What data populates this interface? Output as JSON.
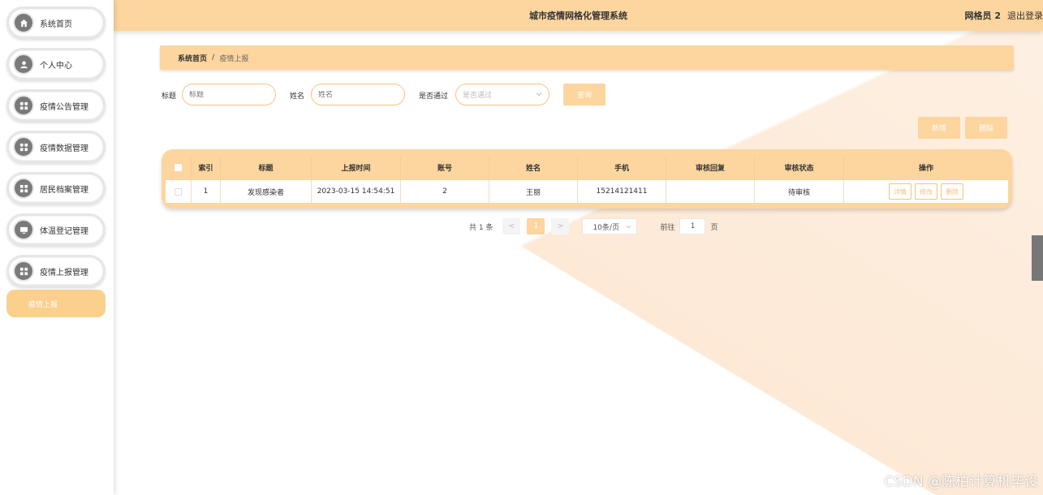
{
  "header": {
    "title": "城市疫情网格化管理系统",
    "user": "网格员 2",
    "logout": "退出登录"
  },
  "sidebar": {
    "items": [
      {
        "label": "系统首页",
        "icon": "home-icon"
      },
      {
        "label": "个人中心",
        "icon": "user-icon"
      },
      {
        "label": "疫情公告管理",
        "icon": "grid-icon"
      },
      {
        "label": "疫情数据管理",
        "icon": "grid-icon"
      },
      {
        "label": "居民档案管理",
        "icon": "grid-icon"
      },
      {
        "label": "体温登记管理",
        "icon": "monitor-icon"
      },
      {
        "label": "疫情上报管理",
        "icon": "grid-icon"
      }
    ],
    "submenu": {
      "label": "疫情上报"
    }
  },
  "breadcrumb": {
    "home": "系统首页",
    "separator": "/",
    "current": "疫情上报"
  },
  "search": {
    "title_label": "标题",
    "title_placeholder": "标题",
    "name_label": "姓名",
    "name_placeholder": "姓名",
    "passed_label": "是否通过",
    "passed_placeholder": "是否通过",
    "query_button": "查询"
  },
  "actions": {
    "add": "新增",
    "delete": "删除"
  },
  "table": {
    "columns": [
      "索引",
      "标题",
      "上报时间",
      "账号",
      "姓名",
      "手机",
      "审核回复",
      "审核状态",
      "操作"
    ],
    "rows": [
      {
        "index": "1",
        "title": "发现感染者",
        "time": "2023-03-15 14:54:51",
        "account": "2",
        "name": "王丽",
        "phone": "15214121411",
        "reply": "",
        "status": "待审核",
        "ops": {
          "detail": "详情",
          "edit": "修改",
          "delete": "删除"
        }
      }
    ]
  },
  "pagination": {
    "total": "共 1 条",
    "prev": "<",
    "page": "1",
    "next": ">",
    "page_size": "10条/页",
    "goto_label": "前往",
    "goto_value": "1",
    "goto_suffix": "页"
  },
  "watermark": "CSDN @陈柏计算机毕设",
  "colors": {
    "accent": "#fdd59e",
    "accent_border": "#f7c27b",
    "submenu": "#fbcf8c"
  }
}
